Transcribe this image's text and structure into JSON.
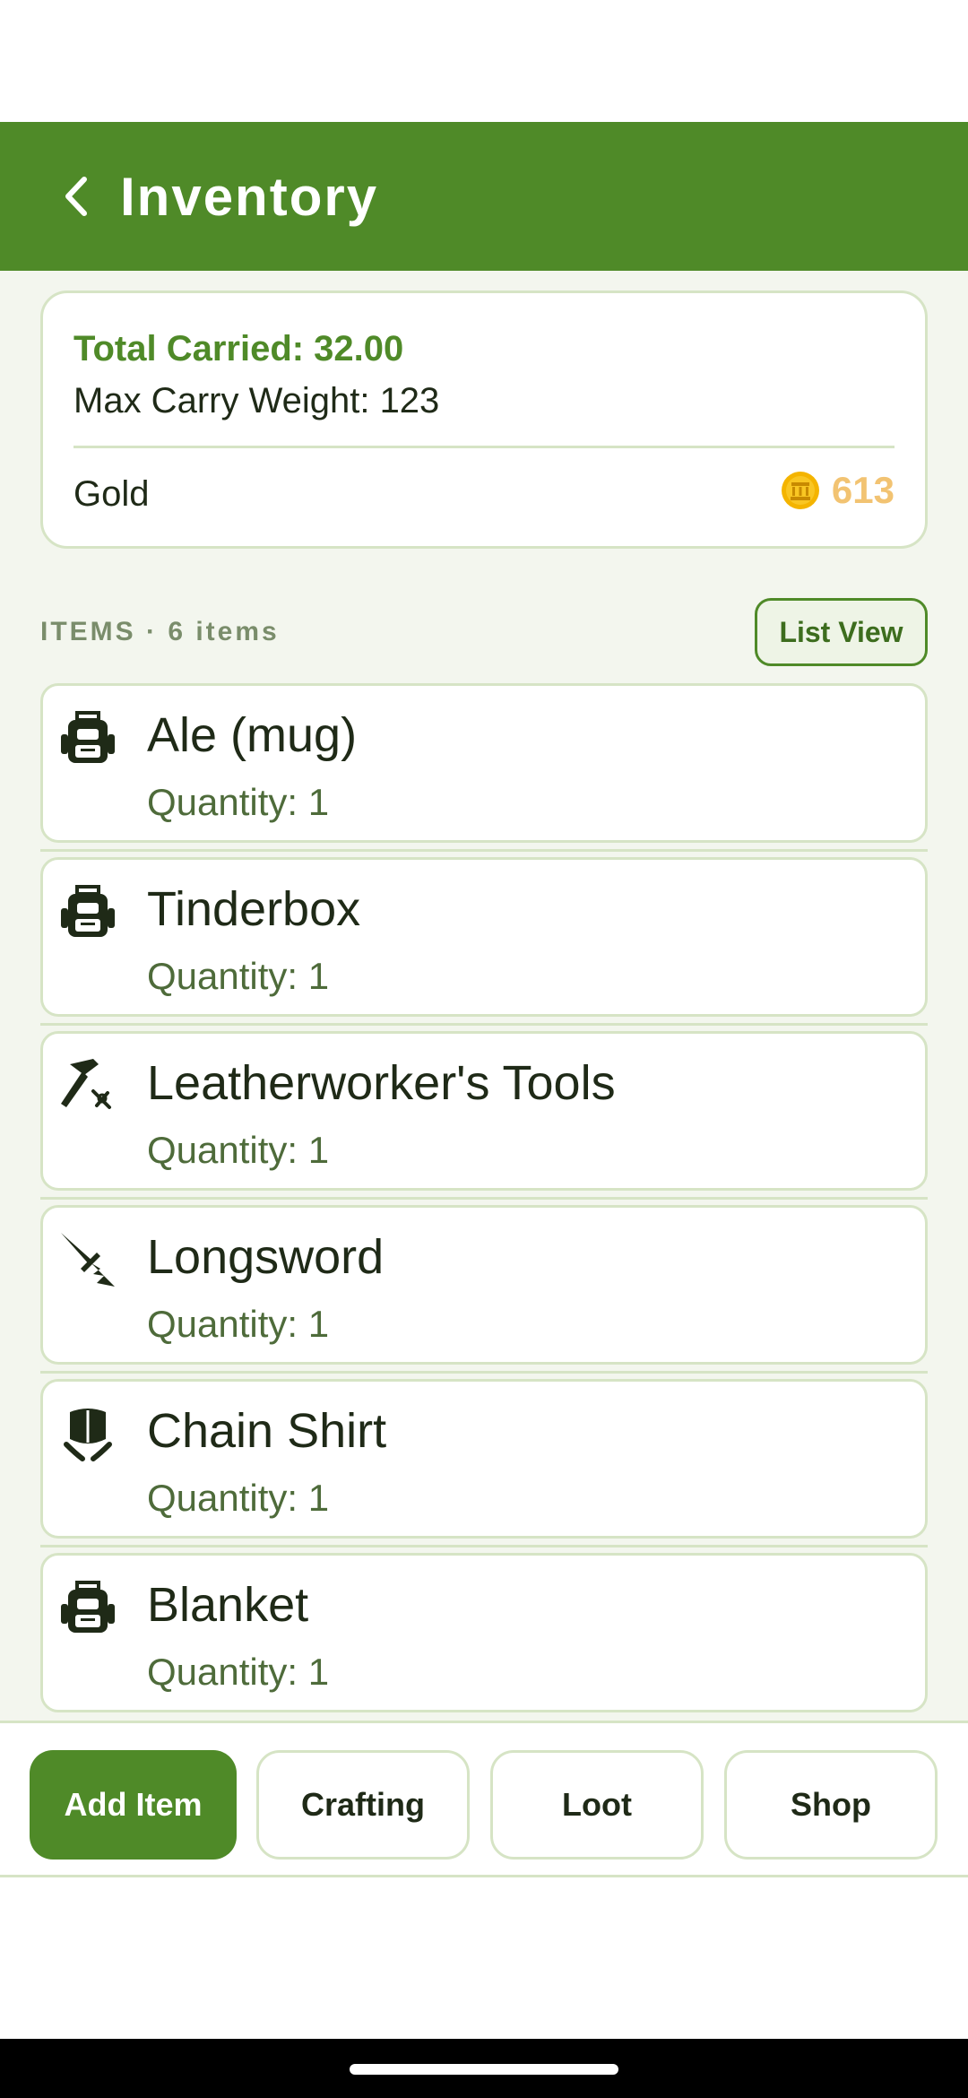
{
  "app_bar": {
    "title": "Inventory"
  },
  "summary": {
    "total_carried": "Total Carried: 32.00",
    "max_carry": "Max Carry Weight: 123",
    "gold_label": "Gold",
    "gold_amount": "613"
  },
  "items_section": {
    "header": "ITEMS · 6 items",
    "list_view_label": "List View"
  },
  "items": [
    {
      "name": "Ale (mug)",
      "quantity": "Quantity: 1",
      "icon": "backpack-icon"
    },
    {
      "name": "Tinderbox",
      "quantity": "Quantity: 1",
      "icon": "backpack-icon"
    },
    {
      "name": "Leatherworker's Tools",
      "quantity": "Quantity: 1",
      "icon": "hammer-icon"
    },
    {
      "name": "Longsword",
      "quantity": "Quantity: 1",
      "icon": "sword-icon"
    },
    {
      "name": "Chain Shirt",
      "quantity": "Quantity: 1",
      "icon": "chest-armor-icon"
    },
    {
      "name": "Blanket",
      "quantity": "Quantity: 1",
      "icon": "backpack-icon"
    }
  ],
  "actions": {
    "add_item": "Add Item",
    "crafting": "Crafting",
    "loot": "Loot",
    "shop": "Shop"
  },
  "colors": {
    "primary": "#4f8a28",
    "card_border": "#d6e4c5",
    "background": "#f3f6ee",
    "gold": "#f2c372",
    "text_dark": "#1f2a17",
    "text_muted": "#4e6b3a"
  }
}
